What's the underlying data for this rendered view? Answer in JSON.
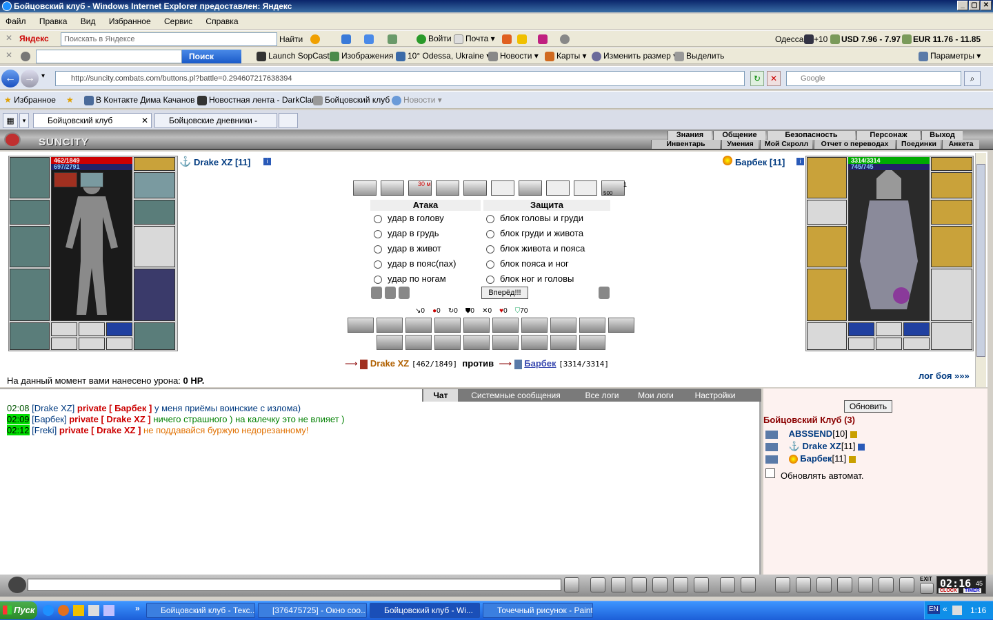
{
  "window": {
    "title": "Бойцовский клуб - Windows Internet Explorer предоставлен: Яндекс",
    "controls": [
      "_",
      "▢",
      "✕"
    ]
  },
  "menu": [
    "Файл",
    "Правка",
    "Вид",
    "Избранное",
    "Сервис",
    "Справка"
  ],
  "yandex_bar": {
    "logo": "Яндекс",
    "search_placeholder": "Поискать в Яндексе",
    "find_label": "Найти",
    "login_label": "Войти",
    "mail_label": "Почта",
    "city": "Одесса",
    "temp": "+10",
    "usd": "USD 7.96 - 7.97",
    "eur": "EUR 11.76 - 11.85"
  },
  "ask_bar": {
    "search_label": "Поиск",
    "items": [
      "Launch SopCast",
      "Изображения",
      "10° Odessa, Ukraine",
      "Новости",
      "Карты",
      "Изменить размер",
      "Выделить"
    ],
    "params_label": "Параметры"
  },
  "address": {
    "url": "http://suncity.combats.com/buttons.pl?battle=0.294607217638394",
    "search_placeholder": "Google"
  },
  "favorites": {
    "label": "Избранное",
    "items": [
      "В Контакте Дима Качанов",
      "Новостная лента - DarkClan",
      "Бойцовский клуб",
      "Новости"
    ]
  },
  "tabs": [
    {
      "label": "Бойцовский клуб",
      "close": "✕"
    },
    {
      "label": "Бойцовские дневники - Dra..."
    }
  ],
  "game": {
    "logo": "SUNCITY",
    "nav_top": [
      "Знания",
      "Общение",
      "Безопасность",
      "Персонаж",
      "Выход"
    ],
    "nav_bottom": [
      "Инвентарь",
      "Умения",
      "Мой Скролл",
      "Отчет о переводах",
      "Поединки",
      "Анкета"
    ],
    "player": {
      "name": "Drake XZ [11]",
      "hp": "462/1849",
      "mana": "697/2791"
    },
    "enemy": {
      "name": "Барбек [11]",
      "hp": "3314/3314",
      "mana": "745/745"
    },
    "attack_title": "Атака",
    "defense_title": "Защита",
    "attacks": [
      "удар в голову",
      "удар в грудь",
      "удар в живот",
      "удар в пояс(пах)",
      "удар по ногам"
    ],
    "blocks": [
      "блок головы и груди",
      "блок груди и живота",
      "блок живота и пояса",
      "блок пояса и ног",
      "блок ног и головы"
    ],
    "forward_button": "Вперёд!!!",
    "scroll_timer": "30 м",
    "scroll_count": "1",
    "scroll_500": "500",
    "counters": [
      "0",
      "0",
      "0",
      "0",
      "0",
      "0",
      "70"
    ],
    "vs": {
      "p1": "Drake XZ",
      "p1hp": "[462/1849]",
      "word": "против",
      "p2": "Барбек",
      "p2hp": "[3314/3314]"
    },
    "damage_prefix": "На данный момент вами нанесено урона:",
    "damage_value": "0 HP.",
    "log_link": "лог боя »»»"
  },
  "chat": {
    "tabs": [
      "Чат",
      "Системные сообщения",
      "Все логи",
      "Мои логи",
      "Настройки"
    ],
    "messages": [
      {
        "time": "02:08",
        "from": "[Drake XZ]",
        "to": "private [ Барбек ]",
        "text": "у меня приёмы воинские с излома)"
      },
      {
        "time": "02:09",
        "from": "[Барбек]",
        "to": "private [ Drake XZ ]",
        "text": "ничего страшного ) на калечку это не влияет )"
      },
      {
        "time": "02:12",
        "from": "[Freki]",
        "to": "private [ Drake XZ ]",
        "text": "не поддавайся буржую недорезанному!"
      }
    ]
  },
  "room": {
    "refresh_button": "Обновить",
    "title": "Бойцовский Клуб (3)",
    "users": [
      {
        "name": "ABSSEND",
        "level": "[10]"
      },
      {
        "name": "Drake XZ",
        "level": "[11]"
      },
      {
        "name": "Барбек",
        "level": "[11]"
      }
    ],
    "auto_refresh": "Обновлять автомат."
  },
  "clock": {
    "time": "02:16",
    "sec": "45",
    "clock_label": "CLOCK",
    "timer_label": "TIMER",
    "exit": "EXIT"
  },
  "taskbar": {
    "start": "Пуск",
    "items": [
      "Бойцовский клуб - Текс...",
      "[376475725] - Окно соо...",
      "Бойцовский клуб - Wi...",
      "Точечный рисунок - Paint"
    ],
    "lang": "EN",
    "time": "1:16"
  }
}
